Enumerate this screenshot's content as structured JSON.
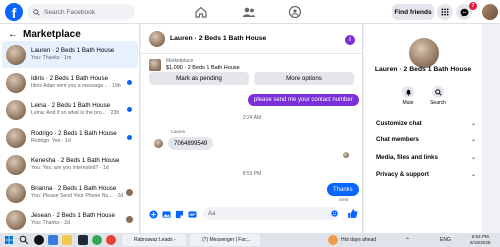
{
  "topbar": {
    "logo_letter": "f",
    "search_placeholder": "Search Facebook",
    "find_friends": "Find friends",
    "notifications_count": "7"
  },
  "sidebar": {
    "title": "Marketplace",
    "conversations": [
      {
        "name": "Lauren · 2 Beds 1 Bath House",
        "preview": "You: Thanks · 1m",
        "active": true,
        "unread": false
      },
      {
        "name": "Idiris · 2 Beds 1 Bath House",
        "preview": "Idiris Adan sent you a message... · 19h",
        "active": false,
        "unread": true
      },
      {
        "name": "Leina · 2 Beds 1 Bath House",
        "preview": "Leina: And if so what is the pro... · 23h",
        "active": false,
        "unread": true
      },
      {
        "name": "Rodrigo · 2 Beds 1 Bath House",
        "preview": "Rodrigo: Yes · 1d",
        "active": false,
        "unread": true
      },
      {
        "name": "Kenesha · 2 Beds 1 Bath House",
        "preview": "You: Yes, are you interested? · 1d",
        "active": false,
        "unread": false
      },
      {
        "name": "Brianna · 2 Beds 1 Bath House",
        "preview": "You: Please Send Your Phone Nu... · 2d",
        "active": false,
        "unread": false,
        "mini": true
      },
      {
        "name": "Jesean · 2 Beds 1 Bath House",
        "preview": "You: Thanks · 2d",
        "active": false,
        "unread": false,
        "mini": true
      }
    ]
  },
  "chat": {
    "title": "Lauren · 2 Beds 1 Bath House",
    "listing_source": "Marketplace",
    "listing_detail": "$1,090 · 2 Beds 1 Bath House",
    "mark_pending": "Mark as pending",
    "more_options": "More options",
    "messages": [
      {
        "text": "please send me your contact number",
        "direction": "out"
      },
      {
        "time": "2:24 AM"
      },
      {
        "sender": "Lauren",
        "text": "7064899549",
        "direction": "in"
      },
      {
        "time": "8:53 PM"
      },
      {
        "text": "Thanks",
        "direction": "out"
      },
      {
        "status": "Sent"
      }
    ],
    "composer_placeholder": "Aa"
  },
  "details": {
    "name": "Lauren · 2 Beds 1 Bath House",
    "mute": "Mute",
    "search": "Search",
    "sections": [
      "Customize chat",
      "Chat members",
      "Media, files and links",
      "Privacy & support"
    ]
  },
  "taskbar": {
    "app1": "Rabnawaz Leads -",
    "app2": "(7) Messenger | Fac...",
    "weather": "Hot days ahead",
    "language": "ENG",
    "time": "8:53 PM",
    "date": "6/18/2025"
  }
}
